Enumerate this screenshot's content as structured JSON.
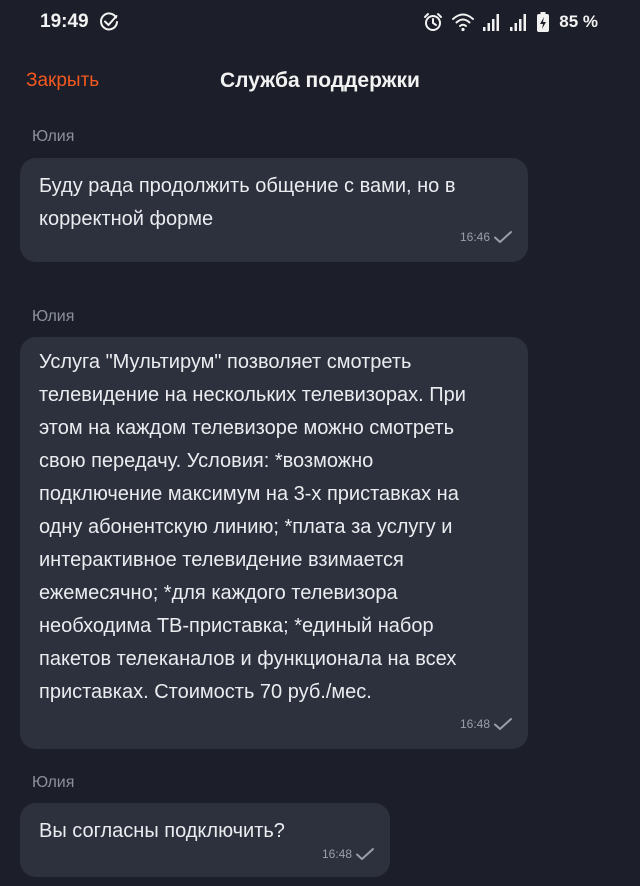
{
  "status_bar": {
    "time": "19:49",
    "battery": "85 %"
  },
  "header": {
    "close_label": "Закрыть",
    "title": "Служба поддержки"
  },
  "messages": [
    {
      "sender": "Юлия",
      "text": "Буду рада продолжить общение с вами, но в\nкорректной форме",
      "time": "16:46"
    },
    {
      "sender": "Юлия",
      "text": "Услуга \"Мультирум\" позволяет смотреть\nтелевидение на нескольких телевизорах. При\nэтом на каждом телевизоре можно смотреть\nсвою передачу. Условия: *возможно\nподключение максимум на 3-х приставках на\nодну абонентскую линию; *плата за услугу и\nинтерактивное телевидение взимается\nежемесячно; *для каждого телевизора\nнеобходима ТВ-приставка; *единый набор\nпакетов телеканалов и функционала на всех\nприставках. Стоимость 70 руб./мес.",
      "time": "16:48"
    },
    {
      "sender": "Юлия",
      "text": "Вы согласны подключить?",
      "time": "16:48"
    }
  ],
  "colors": {
    "background": "#1c1f29",
    "bubble": "#2d313d",
    "accent": "#f4581f"
  },
  "icons": [
    "check-circle-icon",
    "alarm-icon",
    "wifi-icon",
    "signal-icon",
    "battery-charging-icon",
    "read-check-icon"
  ]
}
